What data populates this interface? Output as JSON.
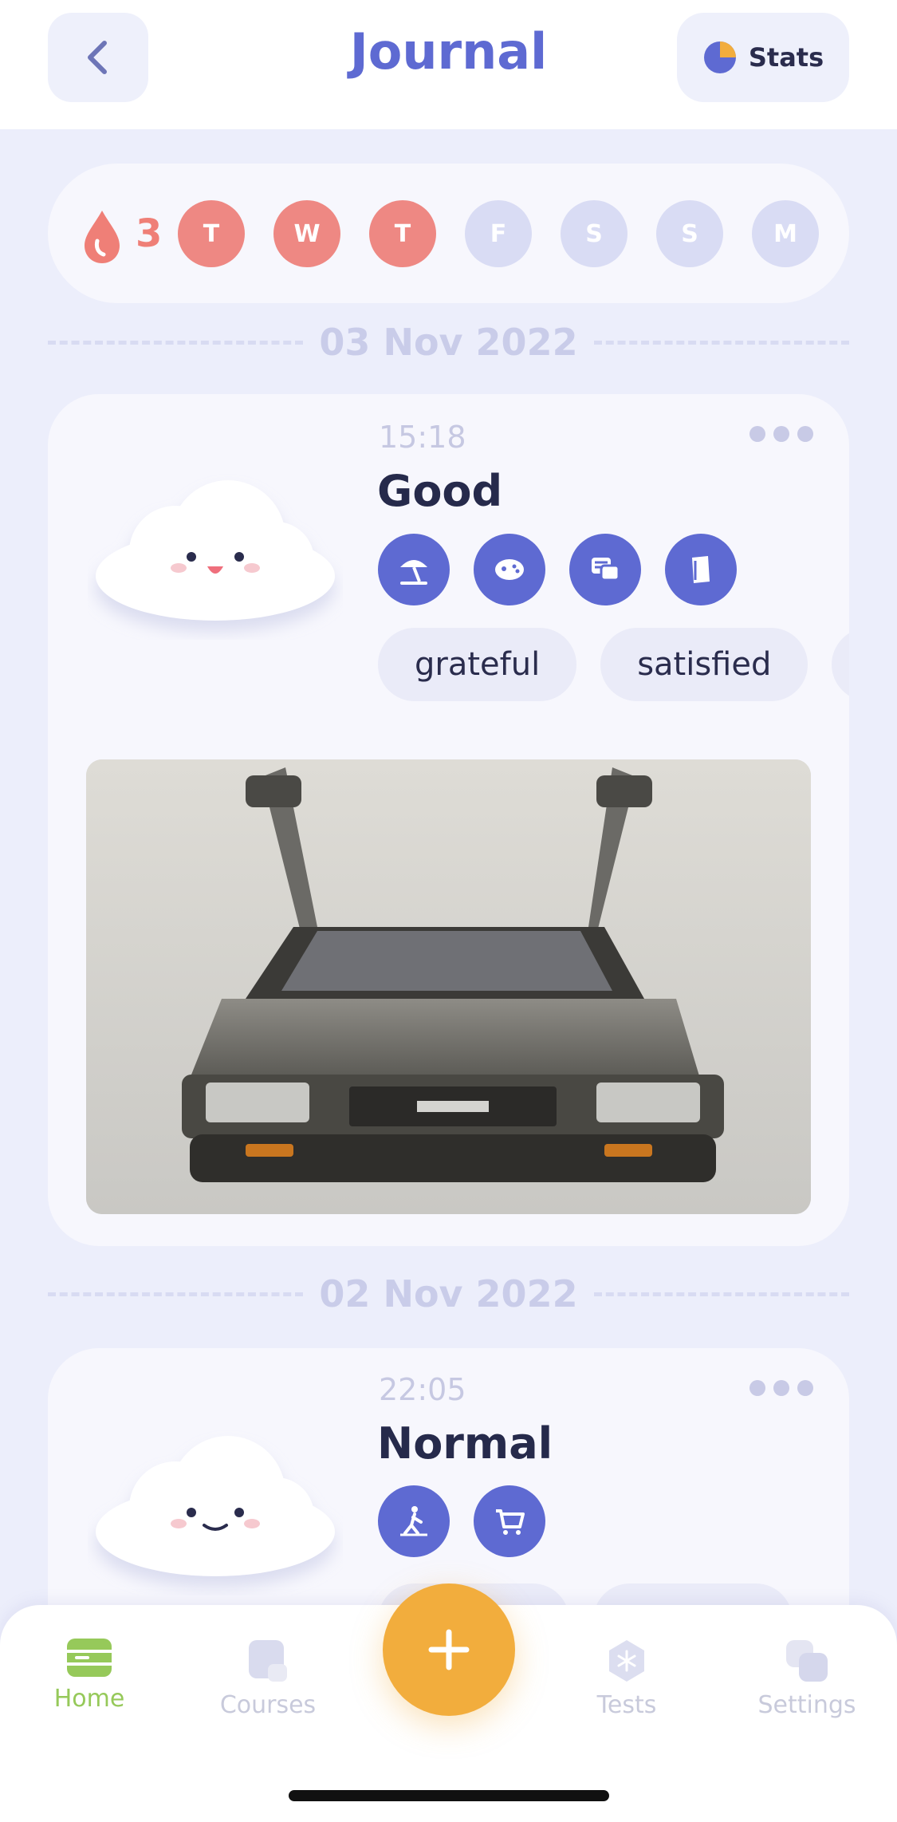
{
  "header": {
    "title": "Journal",
    "stats_label": "Stats",
    "back_icon": "chevron-left-icon",
    "stats_icon": "pie-chart-icon"
  },
  "streak": {
    "count": "3",
    "days": [
      {
        "letter": "T",
        "done": true
      },
      {
        "letter": "W",
        "done": true
      },
      {
        "letter": "T",
        "done": true
      },
      {
        "letter": "F",
        "done": false
      },
      {
        "letter": "S",
        "done": false
      },
      {
        "letter": "S",
        "done": false
      },
      {
        "letter": "M",
        "done": false
      }
    ]
  },
  "entries": [
    {
      "date": "03 Nov 2022",
      "time": "15:18",
      "mood": "Good",
      "activities": [
        "beach-umbrella-icon",
        "game-controller-icon",
        "chat-icon",
        "book-icon"
      ],
      "feelings": [
        "grateful",
        "satisfied"
      ]
    },
    {
      "date": "02 Nov 2022",
      "time": "22:05",
      "mood": "Normal",
      "activities": [
        "walking-person-icon",
        "shopping-cart-icon"
      ]
    }
  ],
  "nav": {
    "items": [
      {
        "label": "Home",
        "active": true
      },
      {
        "label": "Courses",
        "active": false
      },
      {
        "label": "Tests",
        "active": false
      },
      {
        "label": "Settings",
        "active": false
      }
    ],
    "add_label": "+"
  },
  "colors": {
    "accent": "#5e6ad2",
    "streak_done": "#ee8883",
    "streak_todo": "#d9dcf4",
    "fab": "#f2ad3d",
    "nav_active": "#96c95a"
  }
}
